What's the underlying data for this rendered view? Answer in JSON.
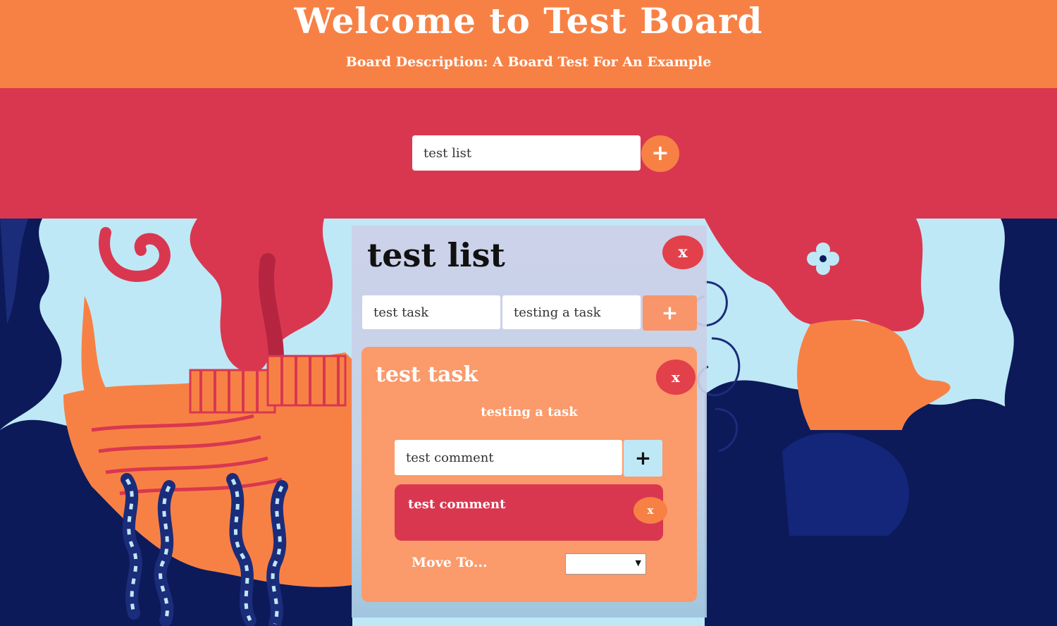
{
  "header": {
    "title": "Welcome to Test Board",
    "description": "Board Description: A Board Test For An Example"
  },
  "add_list": {
    "input_value": "test list",
    "add_label": "+"
  },
  "list": {
    "title": "test list",
    "delete_label": "x",
    "task_name_value": "test task",
    "task_desc_value": "testing a task",
    "add_task_label": "+"
  },
  "task": {
    "title": "test task",
    "delete_label": "x",
    "description": "testing a task",
    "comment_input_value": "test comment",
    "add_comment_label": "+",
    "move_label": "Move To...",
    "move_selected": ""
  },
  "comments": [
    {
      "text": "test comment",
      "delete_label": "x"
    }
  ],
  "colors": {
    "header": "#f78145",
    "band": "#d93750",
    "ocean_dark": "#0c1a5a",
    "ocean_light": "#bfe8f6",
    "task_card": "#fb9a6a",
    "comment_card": "#d93750"
  }
}
